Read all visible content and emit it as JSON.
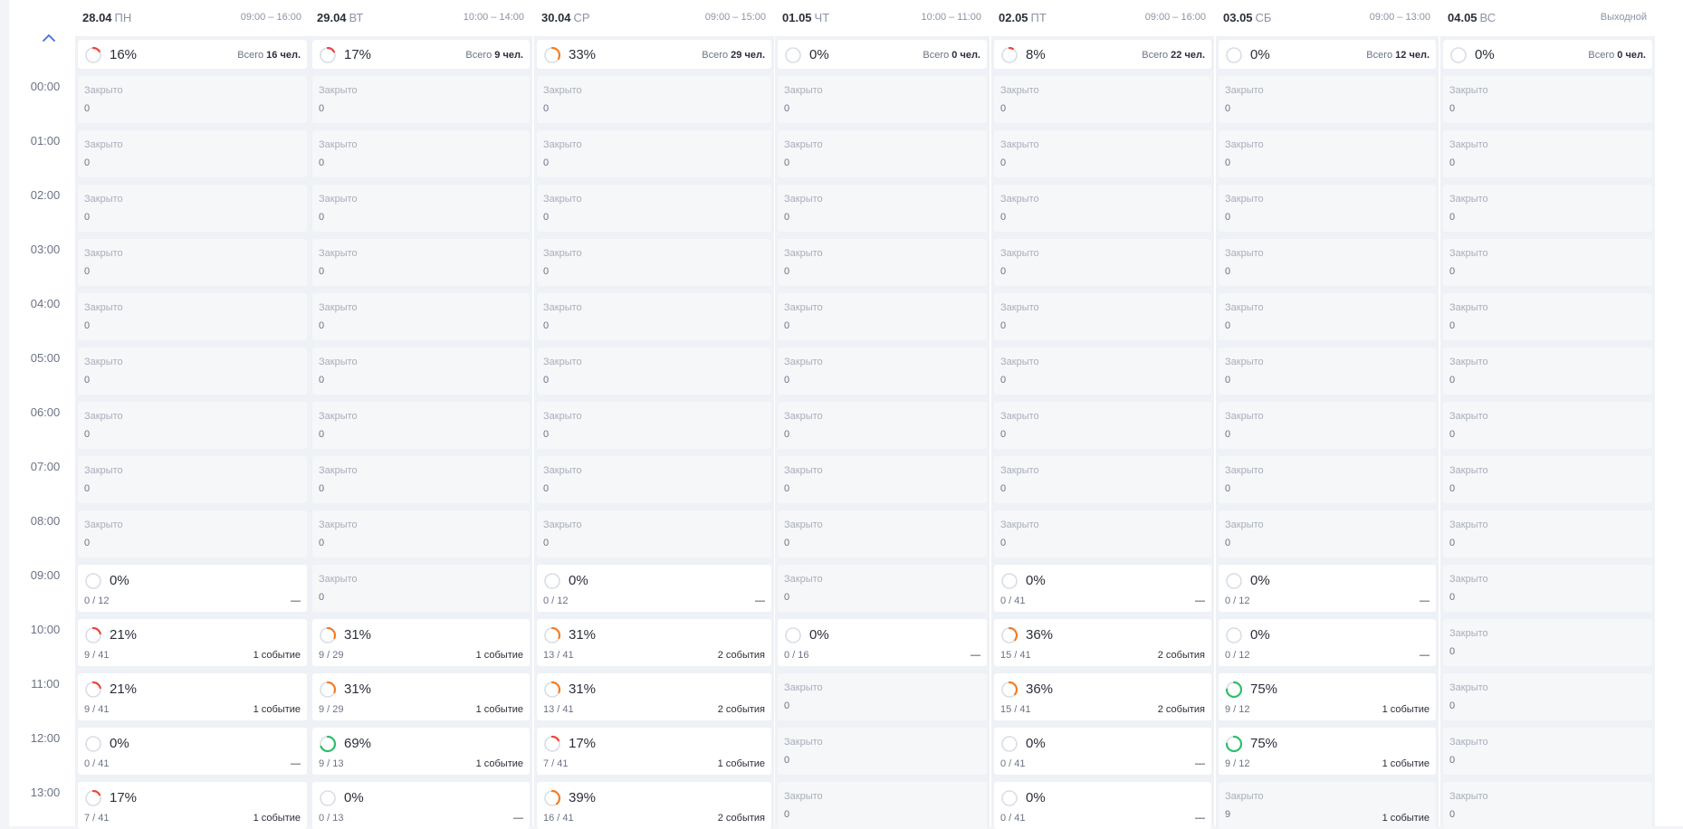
{
  "colors": {
    "red": "#f04438",
    "orange": "#f57c22",
    "green": "#2ebf6a",
    "track": "#d9dde4"
  },
  "labels": {
    "closed": "Закрыто",
    "total_prefix": "Всего",
    "people_suffix": "чел."
  },
  "scroll_up_icon": "chevron-up-icon",
  "times": [
    "00:00",
    "01:00",
    "02:00",
    "03:00",
    "04:00",
    "05:00",
    "06:00",
    "07:00",
    "08:00",
    "09:00",
    "10:00",
    "11:00",
    "12:00",
    "13:00"
  ],
  "days": [
    {
      "date": "28.04",
      "weekday": "ПН",
      "hours": "09:00 – 16:00",
      "summary": {
        "pct": "16%",
        "ring": 16,
        "color": "red",
        "total": "16"
      }
    },
    {
      "date": "29.04",
      "weekday": "ВТ",
      "hours": "10:00 – 14:00",
      "summary": {
        "pct": "17%",
        "ring": 17,
        "color": "red",
        "total": "9"
      }
    },
    {
      "date": "30.04",
      "weekday": "СР",
      "hours": "09:00 – 15:00",
      "summary": {
        "pct": "33%",
        "ring": 33,
        "color": "orange",
        "total": "29"
      }
    },
    {
      "date": "01.05",
      "weekday": "ЧТ",
      "hours": "10:00 – 11:00",
      "summary": {
        "pct": "0%",
        "ring": 0,
        "color": "red",
        "total": "0"
      }
    },
    {
      "date": "02.05",
      "weekday": "ПТ",
      "hours": "09:00 – 16:00",
      "summary": {
        "pct": "8%",
        "ring": 8,
        "color": "red",
        "total": "22"
      }
    },
    {
      "date": "03.05",
      "weekday": "СБ",
      "hours": "09:00 – 13:00",
      "summary": {
        "pct": "0%",
        "ring": 0,
        "color": "red",
        "total": "12"
      }
    },
    {
      "date": "04.05",
      "weekday": "ВС",
      "hours": "Выходной",
      "summary": {
        "pct": "0%",
        "ring": 0,
        "color": "red",
        "total": "0"
      }
    }
  ],
  "rows": [
    [
      {
        "closed": true,
        "value": "0"
      },
      {
        "closed": true,
        "value": "0"
      },
      {
        "closed": true,
        "value": "0"
      },
      {
        "closed": true,
        "value": "0"
      },
      {
        "closed": true,
        "value": "0"
      },
      {
        "closed": true,
        "value": "0"
      },
      {
        "closed": true,
        "value": "0"
      }
    ],
    [
      {
        "closed": true,
        "value": "0"
      },
      {
        "closed": true,
        "value": "0"
      },
      {
        "closed": true,
        "value": "0"
      },
      {
        "closed": true,
        "value": "0"
      },
      {
        "closed": true,
        "value": "0"
      },
      {
        "closed": true,
        "value": "0"
      },
      {
        "closed": true,
        "value": "0"
      }
    ],
    [
      {
        "closed": true,
        "value": "0"
      },
      {
        "closed": true,
        "value": "0"
      },
      {
        "closed": true,
        "value": "0"
      },
      {
        "closed": true,
        "value": "0"
      },
      {
        "closed": true,
        "value": "0"
      },
      {
        "closed": true,
        "value": "0"
      },
      {
        "closed": true,
        "value": "0"
      }
    ],
    [
      {
        "closed": true,
        "value": "0"
      },
      {
        "closed": true,
        "value": "0"
      },
      {
        "closed": true,
        "value": "0"
      },
      {
        "closed": true,
        "value": "0"
      },
      {
        "closed": true,
        "value": "0"
      },
      {
        "closed": true,
        "value": "0"
      },
      {
        "closed": true,
        "value": "0"
      }
    ],
    [
      {
        "closed": true,
        "value": "0"
      },
      {
        "closed": true,
        "value": "0"
      },
      {
        "closed": true,
        "value": "0"
      },
      {
        "closed": true,
        "value": "0"
      },
      {
        "closed": true,
        "value": "0"
      },
      {
        "closed": true,
        "value": "0"
      },
      {
        "closed": true,
        "value": "0"
      }
    ],
    [
      {
        "closed": true,
        "value": "0"
      },
      {
        "closed": true,
        "value": "0"
      },
      {
        "closed": true,
        "value": "0"
      },
      {
        "closed": true,
        "value": "0"
      },
      {
        "closed": true,
        "value": "0"
      },
      {
        "closed": true,
        "value": "0"
      },
      {
        "closed": true,
        "value": "0"
      }
    ],
    [
      {
        "closed": true,
        "value": "0"
      },
      {
        "closed": true,
        "value": "0"
      },
      {
        "closed": true,
        "value": "0"
      },
      {
        "closed": true,
        "value": "0"
      },
      {
        "closed": true,
        "value": "0"
      },
      {
        "closed": true,
        "value": "0"
      },
      {
        "closed": true,
        "value": "0"
      }
    ],
    [
      {
        "closed": true,
        "value": "0"
      },
      {
        "closed": true,
        "value": "0"
      },
      {
        "closed": true,
        "value": "0"
      },
      {
        "closed": true,
        "value": "0"
      },
      {
        "closed": true,
        "value": "0"
      },
      {
        "closed": true,
        "value": "0"
      },
      {
        "closed": true,
        "value": "0"
      }
    ],
    [
      {
        "closed": true,
        "value": "0"
      },
      {
        "closed": true,
        "value": "0"
      },
      {
        "closed": true,
        "value": "0"
      },
      {
        "closed": true,
        "value": "0"
      },
      {
        "closed": true,
        "value": "0"
      },
      {
        "closed": true,
        "value": "0"
      },
      {
        "closed": true,
        "value": "0"
      }
    ],
    [
      {
        "pct": "0%",
        "ring": 0,
        "color": "red",
        "ratio": "0 / 12",
        "events": "—"
      },
      {
        "closed": true,
        "value": "0"
      },
      {
        "pct": "0%",
        "ring": 0,
        "color": "red",
        "ratio": "0 / 12",
        "events": "—"
      },
      {
        "closed": true,
        "value": "0"
      },
      {
        "pct": "0%",
        "ring": 0,
        "color": "red",
        "ratio": "0 / 41",
        "events": "—"
      },
      {
        "pct": "0%",
        "ring": 0,
        "color": "red",
        "ratio": "0 / 12",
        "events": "—"
      },
      {
        "closed": true,
        "value": "0"
      }
    ],
    [
      {
        "pct": "21%",
        "ring": 21,
        "color": "red",
        "ratio": "9 / 41",
        "events": "1 событие"
      },
      {
        "pct": "31%",
        "ring": 31,
        "color": "orange",
        "ratio": "9 / 29",
        "events": "1 событие"
      },
      {
        "pct": "31%",
        "ring": 31,
        "color": "orange",
        "ratio": "13 / 41",
        "events": "2 события"
      },
      {
        "pct": "0%",
        "ring": 0,
        "color": "red",
        "ratio": "0 / 16",
        "events": "—"
      },
      {
        "pct": "36%",
        "ring": 36,
        "color": "orange",
        "ratio": "15 / 41",
        "events": "2 события"
      },
      {
        "pct": "0%",
        "ring": 0,
        "color": "red",
        "ratio": "0 / 12",
        "events": "—"
      },
      {
        "closed": true,
        "value": "0"
      }
    ],
    [
      {
        "pct": "21%",
        "ring": 21,
        "color": "red",
        "ratio": "9 / 41",
        "events": "1 событие"
      },
      {
        "pct": "31%",
        "ring": 31,
        "color": "orange",
        "ratio": "9 / 29",
        "events": "1 событие"
      },
      {
        "pct": "31%",
        "ring": 31,
        "color": "orange",
        "ratio": "13 / 41",
        "events": "2 события"
      },
      {
        "closed": true,
        "value": "0"
      },
      {
        "pct": "36%",
        "ring": 36,
        "color": "orange",
        "ratio": "15 / 41",
        "events": "2 события"
      },
      {
        "pct": "75%",
        "ring": 75,
        "color": "green",
        "ratio": "9 / 12",
        "events": "1 событие"
      },
      {
        "closed": true,
        "value": "0"
      }
    ],
    [
      {
        "pct": "0%",
        "ring": 0,
        "color": "red",
        "ratio": "0 / 41",
        "events": "—"
      },
      {
        "pct": "69%",
        "ring": 69,
        "color": "green",
        "ratio": "9 / 13",
        "events": "1 событие"
      },
      {
        "pct": "17%",
        "ring": 17,
        "color": "red",
        "ratio": "7 / 41",
        "events": "1 событие"
      },
      {
        "closed": true,
        "value": "0"
      },
      {
        "pct": "0%",
        "ring": 0,
        "color": "red",
        "ratio": "0 / 41",
        "events": "—"
      },
      {
        "pct": "75%",
        "ring": 75,
        "color": "green",
        "ratio": "9 / 12",
        "events": "1 событие"
      },
      {
        "closed": true,
        "value": "0"
      }
    ],
    [
      {
        "pct": "17%",
        "ring": 17,
        "color": "red",
        "ratio": "7 / 41",
        "events": "1 событие"
      },
      {
        "pct": "0%",
        "ring": 0,
        "color": "red",
        "ratio": "0 / 13",
        "events": "—"
      },
      {
        "pct": "39%",
        "ring": 39,
        "color": "orange",
        "ratio": "16 / 41",
        "events": "2 события"
      },
      {
        "closed": true,
        "value": "0"
      },
      {
        "pct": "0%",
        "ring": 0,
        "color": "red",
        "ratio": "0 / 41",
        "events": "—"
      },
      {
        "closed": true,
        "value": "9",
        "events": "1 событие"
      },
      {
        "closed": true,
        "value": "0"
      }
    ]
  ]
}
